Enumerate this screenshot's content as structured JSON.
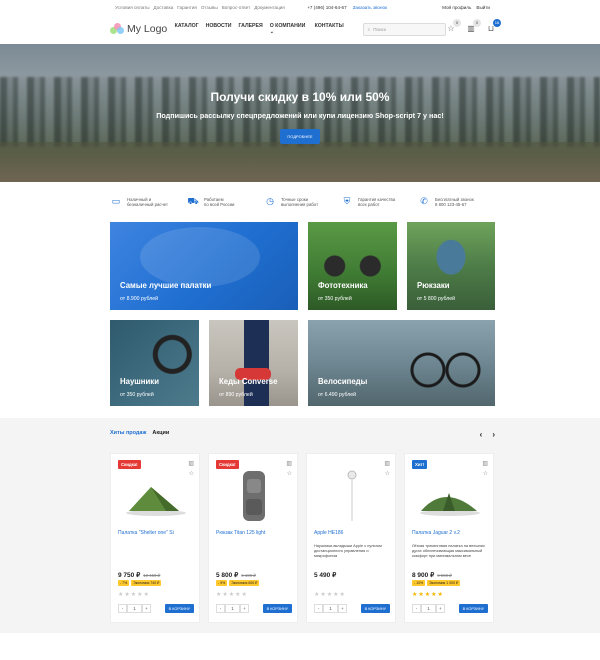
{
  "topbar": {
    "links": [
      "Условия оплаты",
      "Доставка",
      "Гарантия",
      "Отзывы",
      "Вопрос-ответ",
      "Документация"
    ],
    "phone": "+7 (496) 104-64-67",
    "callback": "Заказать звонок",
    "profile": "Мой профиль",
    "logout": "Выйти"
  },
  "header": {
    "logo": "My Logo",
    "nav": [
      "КАТАЛОГ",
      "НОВОСТИ",
      "ГАЛЕРЕЯ",
      "О КОМПАНИИ",
      "КОНТАКТЫ"
    ],
    "search_placeholder": "Поиск",
    "badges": {
      "favorites": "0",
      "compare": "0",
      "cart": "16"
    }
  },
  "hero": {
    "title": "Получи скидку в 10% или 50%",
    "subtitle": "Подпишись рассылку спецпредложений или купи лицензию Shop-script 7 у нас!",
    "button": "ПОДРОБНЕЕ"
  },
  "features": [
    {
      "icon": "card-icon",
      "line1": "Наличный и",
      "line2": "безналичный расчет"
    },
    {
      "icon": "truck-icon",
      "line1": "Работаем",
      "line2": "по всей России"
    },
    {
      "icon": "clock-icon",
      "line1": "Точные сроки",
      "line2": "выполнения работ"
    },
    {
      "icon": "shield-icon",
      "line1": "Гарантия качества",
      "line2": "всех работ"
    },
    {
      "icon": "phone-icon",
      "line1": "Бесплатный звонок",
      "line2": "8 800 123-45-67"
    }
  ],
  "categories": [
    {
      "title": "Самые лучшие палатки",
      "price": "от 8.900 рублей"
    },
    {
      "title": "Фототехника",
      "price": "от 350 рублей"
    },
    {
      "title": "Рюкзаки",
      "price": "от 5 800 рублей"
    },
    {
      "title": "Наушники",
      "price": "от 350 рублей"
    },
    {
      "title": "Кеды Converse",
      "price": "от 890 рублей"
    },
    {
      "title": "Велосипеды",
      "price": "от 6.490 рублей"
    }
  ],
  "products_section": {
    "tabs": [
      "Хиты продаж",
      "Акции"
    ],
    "prev": "‹",
    "next": "›"
  },
  "products": [
    {
      "label": "Скидка!",
      "name": "Палатка \"Shelter one\" Si",
      "desc": "",
      "price": "9 750 ₽",
      "old_price": "10 450 ₽",
      "disc1": "- 7%",
      "disc2": "Экономия 740 ₽",
      "stars_filled": 0,
      "buy": "В КОРЗИНУ"
    },
    {
      "label": "Скидка!",
      "name": "Рюкзак Titan 125 light",
      "desc": "",
      "price": "5 800 ₽",
      "old_price": "6 400 ₽",
      "disc1": "- 9%",
      "disc2": "Экономия 600 ₽",
      "stars_filled": 0,
      "buy": "В КОРЗИНУ"
    },
    {
      "label": "",
      "name": "Apple HE186",
      "desc": "Наушники-вкладыши Apple с пультом дистанционного управления и микрофоном",
      "price": "5 490 ₽",
      "old_price": "",
      "disc1": "",
      "disc2": "",
      "stars_filled": 0,
      "buy": "В КОРЗИНУ"
    },
    {
      "label": "Хит!",
      "name": "Палатка Jaguar 2 v.2",
      "desc": "Лёгкая трекинговая палатка на внешних дугах обеспечивающая максимальный комфорт при минимальном весе",
      "price": "8 900 ₽",
      "old_price": "9 900 ₽",
      "disc1": "- 10%",
      "disc2": "Экономия 1 000 ₽",
      "stars_filled": 5,
      "buy": "В КОРЗИНУ"
    }
  ],
  "colors": {
    "accent": "#1f6fd1",
    "sale": "#e53935",
    "hit": "#1f6fd1",
    "discount": "#ffc82c"
  }
}
